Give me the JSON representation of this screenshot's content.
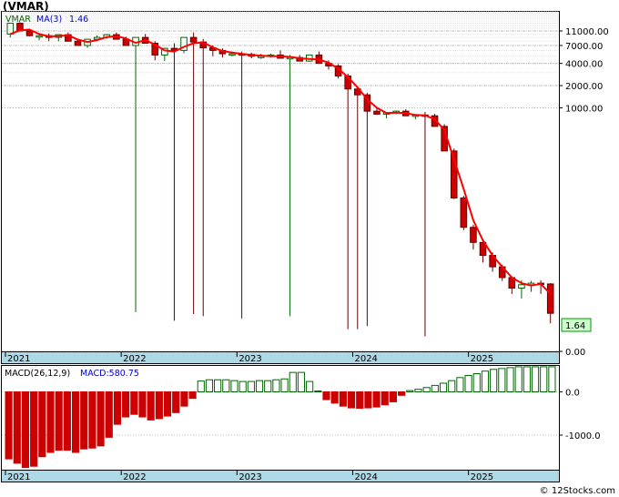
{
  "title": "(VMAR)",
  "footer": "© 12Stocks.com",
  "colors": {
    "up": "#006600",
    "down": "#cc0000",
    "ma": "#ff0000",
    "ma_recent": "#0000cc",
    "axis_band": "#add8e6",
    "price_tag_bg": "#ccffcc",
    "grid": "#d0d0d0"
  },
  "chart_data": [
    {
      "type": "candlestick",
      "name": "price",
      "scale": "log",
      "legend": {
        "ticker": "VMAR",
        "ma_label": "MA(3)",
        "ma_value": "1.46"
      },
      "yticks": [
        "11000.00",
        "7000.00",
        "4000.00",
        "2000.00",
        "1000.00",
        "0.00"
      ],
      "ytick_values": [
        11000,
        7000,
        4000,
        2000,
        1000,
        0.5
      ],
      "ylim": [
        0.5,
        20000
      ],
      "last_price": "1.64",
      "last_price_value": 1.64,
      "x": [
        "2021-01",
        "2021-02",
        "2021-03",
        "2021-04",
        "2021-05",
        "2021-06",
        "2021-07",
        "2021-08",
        "2021-09",
        "2021-10",
        "2021-11",
        "2021-12",
        "2022-01",
        "2022-02",
        "2022-03",
        "2022-04",
        "2022-05",
        "2022-06",
        "2022-07",
        "2022-08",
        "2022-09",
        "2022-10",
        "2022-11",
        "2022-12",
        "2023-01",
        "2023-02",
        "2023-03",
        "2023-04",
        "2023-05",
        "2023-06",
        "2023-07",
        "2023-08",
        "2023-09",
        "2023-10",
        "2023-11",
        "2023-12",
        "2024-01",
        "2024-02",
        "2024-03",
        "2024-04",
        "2024-05",
        "2024-06",
        "2024-07",
        "2024-08",
        "2024-09",
        "2024-10",
        "2024-11",
        "2024-12",
        "2025-01",
        "2025-02",
        "2025-03",
        "2025-04",
        "2025-05",
        "2025-06",
        "2025-07",
        "2025-08",
        "2025-09"
      ],
      "xlabels": [
        {
          "label": "2021",
          "index": 0
        },
        {
          "label": "2022",
          "index": 12
        },
        {
          "label": "2023",
          "index": 24
        },
        {
          "label": "2024",
          "index": 36
        },
        {
          "label": "2025",
          "index": 48
        }
      ],
      "open": [
        10000,
        14000,
        11000,
        9500,
        9500,
        9000,
        9800,
        8000,
        7000,
        8500,
        9000,
        9800,
        8500,
        7000,
        9000,
        7500,
        5200,
        6400,
        6000,
        9000,
        7800,
        6500,
        6000,
        5400,
        5400,
        5300,
        5000,
        5000,
        5200,
        4700,
        4800,
        4300,
        5200,
        4000,
        3700,
        2700,
        1800,
        1500,
        900,
        820,
        860,
        900,
        780,
        800,
        780,
        560,
        260,
        60,
        24,
        15,
        10,
        7,
        5,
        3.6,
        4.0,
        4.2,
        4.1
      ],
      "high": [
        12500,
        14500,
        11500,
        10000,
        10200,
        9800,
        10500,
        8600,
        7800,
        9600,
        10000,
        10500,
        9200,
        7800,
        10000,
        8000,
        5600,
        7500,
        8000,
        10500,
        8600,
        7000,
        6400,
        5800,
        5800,
        5600,
        5400,
        5400,
        6000,
        5200,
        5200,
        4900,
        5800,
        4400,
        3900,
        2900,
        1900,
        1600,
        980,
        880,
        920,
        960,
        820,
        880,
        830,
        600,
        280,
        64,
        26,
        16,
        11,
        7.5,
        5.2,
        4.6,
        4.5,
        4.6,
        4.2
      ],
      "low": [
        9000,
        11000,
        9300,
        8200,
        8000,
        8000,
        9000,
        7000,
        6500,
        8000,
        8600,
        9200,
        7200,
        1.7,
        8000,
        4400,
        4300,
        1.3,
        5500,
        1.6,
        1.5,
        5000,
        4800,
        5000,
        1.4,
        4700,
        4600,
        4800,
        4700,
        1.5,
        4400,
        4200,
        4000,
        3300,
        2500,
        1.0,
        1.0,
        1.1,
        800,
        720,
        820,
        860,
        700,
        0.8,
        560,
        280,
        58,
        22,
        12,
        8,
        6,
        4.5,
        3.0,
        2.6,
        3.2,
        3.0,
        1.2
      ],
      "close": [
        14000,
        11000,
        9500,
        9500,
        9000,
        9800,
        8000,
        7000,
        8500,
        9000,
        9800,
        8500,
        7000,
        9000,
        7500,
        5200,
        6400,
        6000,
        9000,
        7800,
        6500,
        6000,
        5400,
        5400,
        5300,
        5000,
        5000,
        5200,
        4700,
        4800,
        4300,
        5200,
        4000,
        3700,
        2700,
        1800,
        1500,
        900,
        820,
        860,
        900,
        780,
        800,
        780,
        560,
        260,
        60,
        24,
        15,
        10,
        7,
        5,
        3.6,
        4.0,
        4.2,
        4.1,
        1.64
      ],
      "ma3": [
        10000,
        11200,
        11500,
        10000,
        9300,
        9400,
        9600,
        8400,
        7800,
        8300,
        9100,
        9400,
        8700,
        7600,
        8300,
        7200,
        6000,
        5800,
        6700,
        7500,
        7700,
        6600,
        5900,
        5600,
        5400,
        5200,
        5100,
        5000,
        5000,
        4900,
        4700,
        4600,
        4500,
        4100,
        3400,
        2600,
        1900,
        1300,
        1000,
        850,
        860,
        850,
        800,
        790,
        700,
        500,
        200,
        80,
        30,
        16,
        10,
        7,
        5,
        4.2,
        3.9,
        4.1,
        3.0
      ]
    },
    {
      "type": "bar",
      "name": "macd",
      "legend": {
        "label": "MACD(26,12,9)",
        "value_label": "MACD:580.75"
      },
      "yticks": [
        "0.0",
        "-1000.0"
      ],
      "ytick_values": [
        0,
        -1000
      ],
      "ylim": [
        -1800,
        600
      ],
      "values": [
        -1550,
        -1650,
        -1750,
        -1720,
        -1500,
        -1400,
        -1350,
        -1350,
        -1400,
        -1320,
        -1300,
        -1250,
        -1050,
        -750,
        -580,
        -520,
        -580,
        -650,
        -620,
        -560,
        -480,
        -330,
        -150,
        250,
        280,
        280,
        280,
        260,
        240,
        240,
        260,
        260,
        280,
        300,
        450,
        450,
        240,
        20,
        -180,
        -260,
        -330,
        -370,
        -380,
        -370,
        -350,
        -300,
        -230,
        -80,
        30,
        60,
        100,
        150,
        200,
        260,
        330,
        380,
        420,
        480,
        520,
        540,
        560,
        580,
        580,
        580,
        580,
        581
      ],
      "x_count": 64,
      "xlabels": [
        {
          "label": "2021",
          "index": 0
        },
        {
          "label": "2022",
          "index": 12
        },
        {
          "label": "2023",
          "index": 24
        },
        {
          "label": "2024",
          "index": 36
        },
        {
          "label": "2025",
          "index": 48
        }
      ]
    }
  ]
}
